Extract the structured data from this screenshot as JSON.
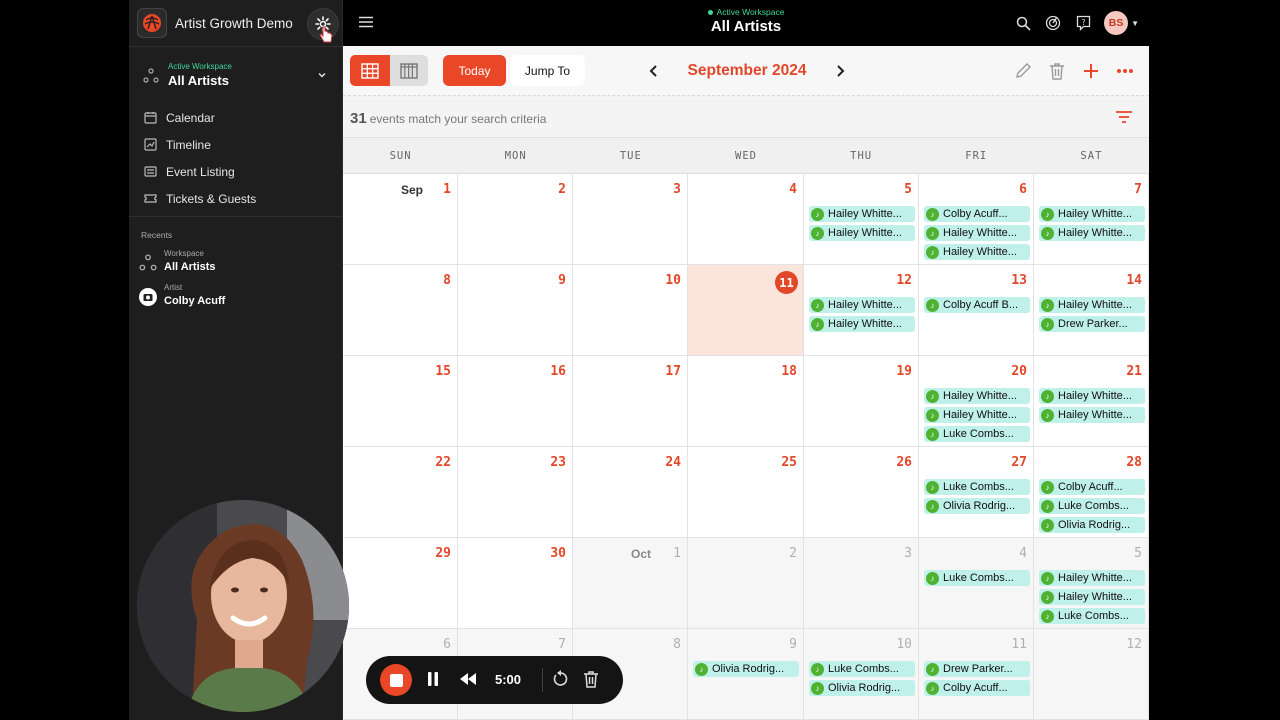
{
  "app": {
    "name": "Artist Growth Demo"
  },
  "sidebar": {
    "workspace": {
      "caption": "Active Workspace",
      "name": "All Artists"
    },
    "nav": [
      {
        "label": "Calendar",
        "icon": "calendar-icon"
      },
      {
        "label": "Timeline",
        "icon": "timeline-icon"
      },
      {
        "label": "Event Listing",
        "icon": "list-icon"
      },
      {
        "label": "Tickets & Guests",
        "icon": "ticket-icon"
      }
    ],
    "recents_title": "Recents",
    "recents": [
      {
        "caption": "Workspace",
        "name": "All Artists"
      },
      {
        "caption": "Artist",
        "name": "Colby Acuff"
      }
    ]
  },
  "header": {
    "caption": "Active Workspace",
    "title": "All Artists",
    "avatar_initials": "BS"
  },
  "toolbar": {
    "today_label": "Today",
    "jump_label": "Jump To",
    "month_title": "September 2024"
  },
  "results": {
    "count": "31",
    "text": "events match your search criteria"
  },
  "calendar": {
    "weekdays": [
      "SUN",
      "MON",
      "TUE",
      "WED",
      "THU",
      "FRI",
      "SAT"
    ],
    "weeks": [
      [
        {
          "day": "1",
          "month": "Sep",
          "events": []
        },
        {
          "day": "2",
          "events": []
        },
        {
          "day": "3",
          "events": []
        },
        {
          "day": "4",
          "events": []
        },
        {
          "day": "5",
          "events": [
            "Hailey Whitte...",
            "Hailey Whitte..."
          ]
        },
        {
          "day": "6",
          "events": [
            "Colby Acuff...",
            "Hailey Whitte...",
            "Hailey Whitte..."
          ]
        },
        {
          "day": "7",
          "events": [
            "Hailey Whitte...",
            "Hailey Whitte..."
          ]
        }
      ],
      [
        {
          "day": "8",
          "events": []
        },
        {
          "day": "9",
          "events": []
        },
        {
          "day": "10",
          "events": []
        },
        {
          "day": "11",
          "today": true,
          "events": []
        },
        {
          "day": "12",
          "events": [
            "Hailey Whitte...",
            "Hailey Whitte..."
          ]
        },
        {
          "day": "13",
          "events": [
            "Colby Acuff B..."
          ]
        },
        {
          "day": "14",
          "events": [
            "Hailey Whitte...",
            "Drew Parker..."
          ]
        }
      ],
      [
        {
          "day": "15",
          "events": []
        },
        {
          "day": "16",
          "events": []
        },
        {
          "day": "17",
          "events": []
        },
        {
          "day": "18",
          "events": []
        },
        {
          "day": "19",
          "events": []
        },
        {
          "day": "20",
          "events": [
            "Hailey Whitte...",
            "Hailey Whitte...",
            "Luke Combs..."
          ]
        },
        {
          "day": "21",
          "events": [
            "Hailey Whitte...",
            "Hailey Whitte..."
          ]
        }
      ],
      [
        {
          "day": "22",
          "events": []
        },
        {
          "day": "23",
          "events": []
        },
        {
          "day": "24",
          "events": []
        },
        {
          "day": "25",
          "events": []
        },
        {
          "day": "26",
          "events": []
        },
        {
          "day": "27",
          "events": [
            "Luke Combs...",
            "Olivia Rodrig..."
          ]
        },
        {
          "day": "28",
          "events": [
            "Colby Acuff...",
            "Luke Combs...",
            "Olivia Rodrig..."
          ]
        }
      ],
      [
        {
          "day": "29",
          "events": []
        },
        {
          "day": "30",
          "events": []
        },
        {
          "day": "1",
          "month": "Oct",
          "other": true,
          "events": []
        },
        {
          "day": "2",
          "other": true,
          "events": []
        },
        {
          "day": "3",
          "other": true,
          "events": []
        },
        {
          "day": "4",
          "other": true,
          "events": [
            "Luke Combs..."
          ]
        },
        {
          "day": "5",
          "other": true,
          "events": [
            "Hailey Whitte...",
            "Hailey Whitte...",
            "Luke Combs..."
          ]
        }
      ],
      [
        {
          "day": "6",
          "other": true,
          "events": []
        },
        {
          "day": "7",
          "other": true,
          "events": []
        },
        {
          "day": "8",
          "other": true,
          "events": []
        },
        {
          "day": "9",
          "other": true,
          "events": [
            "Olivia Rodrig..."
          ]
        },
        {
          "day": "10",
          "other": true,
          "events": [
            "Luke Combs...",
            "Olivia Rodrig..."
          ]
        },
        {
          "day": "11",
          "other": true,
          "events": [
            "Drew Parker...",
            "Colby Acuff..."
          ]
        },
        {
          "day": "12",
          "other": true,
          "events": []
        }
      ]
    ]
  },
  "recorder": {
    "time": "5:00"
  },
  "colors": {
    "accent": "#e94727",
    "event_bg": "#bff0ea",
    "event_icon": "#4fb233",
    "workspace_caption": "#3fd6a0"
  }
}
